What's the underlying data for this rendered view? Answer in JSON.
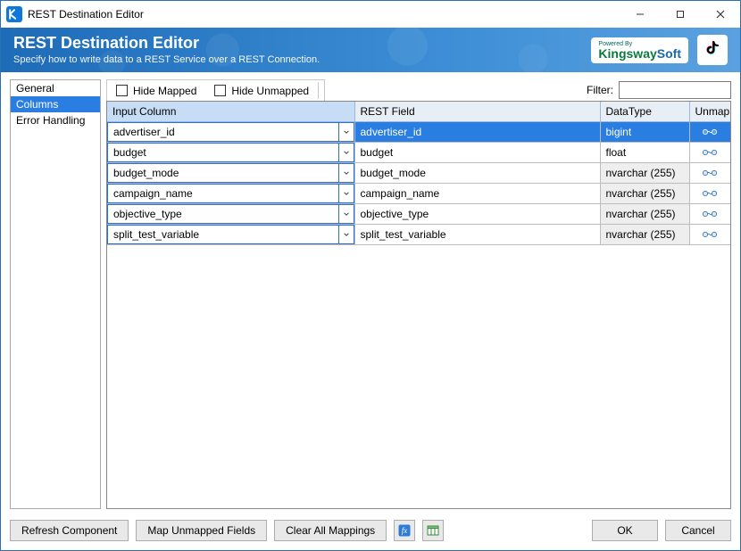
{
  "window": {
    "title": "REST Destination Editor"
  },
  "header": {
    "title": "REST Destination Editor",
    "subtitle": "Specify how to write data to a REST Service over a REST Connection.",
    "poweredBy": "Powered By",
    "brand": {
      "part1": "Kingsway",
      "part2": "Soft"
    }
  },
  "sidebar": {
    "items": [
      {
        "label": "General",
        "selected": false
      },
      {
        "label": "Columns",
        "selected": true
      },
      {
        "label": "Error Handling",
        "selected": false
      }
    ]
  },
  "toolbar": {
    "hideMapped": "Hide Mapped",
    "hideUnmapped": "Hide Unmapped",
    "filterLabel": "Filter:",
    "filterValue": ""
  },
  "grid": {
    "headers": {
      "input": "Input Column",
      "rest": "REST Field",
      "datatype": "DataType",
      "unmap": "Unmap"
    },
    "rows": [
      {
        "input": "advertiser_id",
        "rest": "advertiser_id",
        "datatype": "bigint",
        "dtDisabled": false,
        "selected": true
      },
      {
        "input": "budget",
        "rest": "budget",
        "datatype": "float",
        "dtDisabled": false,
        "selected": false
      },
      {
        "input": "budget_mode",
        "rest": "budget_mode",
        "datatype": "nvarchar (255)",
        "dtDisabled": true,
        "selected": false
      },
      {
        "input": "campaign_name",
        "rest": "campaign_name",
        "datatype": "nvarchar (255)",
        "dtDisabled": true,
        "selected": false
      },
      {
        "input": "objective_type",
        "rest": "objective_type",
        "datatype": "nvarchar (255)",
        "dtDisabled": true,
        "selected": false
      },
      {
        "input": "split_test_variable",
        "rest": "split_test_variable",
        "datatype": "nvarchar (255)",
        "dtDisabled": true,
        "selected": false
      }
    ]
  },
  "footer": {
    "refresh": "Refresh Component",
    "mapUnmapped": "Map Unmapped Fields",
    "clearAll": "Clear All Mappings",
    "ok": "OK",
    "cancel": "Cancel"
  },
  "icons": {
    "chevronDown": "chevron-down-icon",
    "unmap": "unmap-icon",
    "fx": "fx-icon",
    "columns": "columns-icon",
    "tiktok": "tiktok-icon",
    "app": "app-icon",
    "minimize": "minimize-icon",
    "maximize": "maximize-icon",
    "close": "close-icon"
  }
}
